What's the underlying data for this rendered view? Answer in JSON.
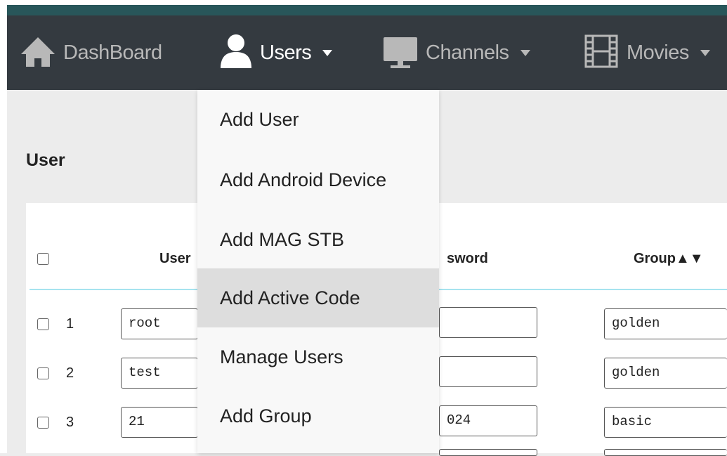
{
  "navbar": {
    "items": [
      {
        "label": "DashBoard",
        "icon": "home-icon"
      },
      {
        "label": "Users",
        "icon": "user-icon",
        "active": true
      },
      {
        "label": "Channels",
        "icon": "monitor-icon"
      },
      {
        "label": "Movies",
        "icon": "film-icon"
      }
    ]
  },
  "page": {
    "title": "User"
  },
  "table": {
    "headers": {
      "user": "User",
      "password": "sword",
      "group": "Group▲▼"
    },
    "rows": [
      {
        "num": "1",
        "user": "root",
        "password": "",
        "group": "golden"
      },
      {
        "num": "2",
        "user": "test",
        "password": "",
        "group": "golden"
      },
      {
        "num": "3",
        "user": "21",
        "password": "024",
        "group": "basic"
      }
    ]
  },
  "users_menu": {
    "items": [
      "Add User",
      "Add Android Device",
      "Add MAG STB",
      "Add Active Code",
      "Manage Users",
      "Add Group"
    ],
    "hovered": "Add Active Code"
  },
  "colors": {
    "navbar": "#343a40",
    "accent": "#28565a",
    "header_rule": "#a6e3ef",
    "hover": "#dddddd"
  }
}
